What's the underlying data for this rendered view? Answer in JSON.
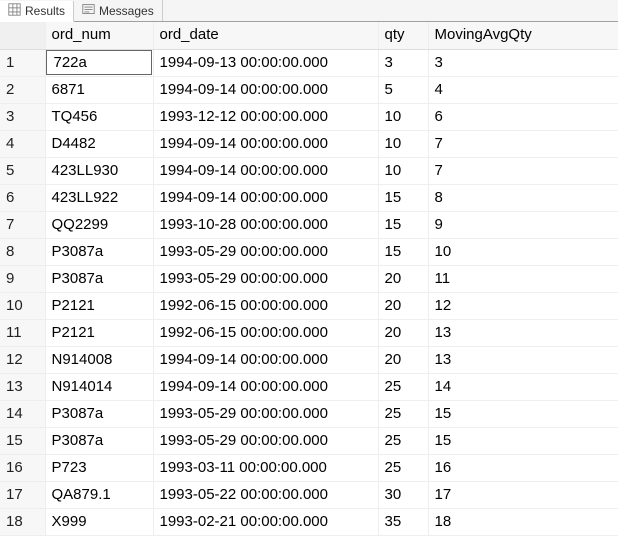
{
  "tabs": {
    "results": "Results",
    "messages": "Messages"
  },
  "columns": [
    "ord_num",
    "ord_date",
    "qty",
    "MovingAvgQty"
  ],
  "rows": [
    {
      "n": "1",
      "ord_num": "722a",
      "ord_date": "1994-09-13 00:00:00.000",
      "qty": "3",
      "mavg": "3"
    },
    {
      "n": "2",
      "ord_num": "6871",
      "ord_date": "1994-09-14 00:00:00.000",
      "qty": "5",
      "mavg": "4"
    },
    {
      "n": "3",
      "ord_num": "TQ456",
      "ord_date": "1993-12-12 00:00:00.000",
      "qty": "10",
      "mavg": "6"
    },
    {
      "n": "4",
      "ord_num": "D4482",
      "ord_date": "1994-09-14 00:00:00.000",
      "qty": "10",
      "mavg": "7"
    },
    {
      "n": "5",
      "ord_num": "423LL930",
      "ord_date": "1994-09-14 00:00:00.000",
      "qty": "10",
      "mavg": "7"
    },
    {
      "n": "6",
      "ord_num": "423LL922",
      "ord_date": "1994-09-14 00:00:00.000",
      "qty": "15",
      "mavg": "8"
    },
    {
      "n": "7",
      "ord_num": "QQ2299",
      "ord_date": "1993-10-28 00:00:00.000",
      "qty": "15",
      "mavg": "9"
    },
    {
      "n": "8",
      "ord_num": "P3087a",
      "ord_date": "1993-05-29 00:00:00.000",
      "qty": "15",
      "mavg": "10"
    },
    {
      "n": "9",
      "ord_num": "P3087a",
      "ord_date": "1993-05-29 00:00:00.000",
      "qty": "20",
      "mavg": "11"
    },
    {
      "n": "10",
      "ord_num": "P2121",
      "ord_date": "1992-06-15 00:00:00.000",
      "qty": "20",
      "mavg": "12"
    },
    {
      "n": "11",
      "ord_num": "P2121",
      "ord_date": "1992-06-15 00:00:00.000",
      "qty": "20",
      "mavg": "13"
    },
    {
      "n": "12",
      "ord_num": "N914008",
      "ord_date": "1994-09-14 00:00:00.000",
      "qty": "20",
      "mavg": "13"
    },
    {
      "n": "13",
      "ord_num": "N914014",
      "ord_date": "1994-09-14 00:00:00.000",
      "qty": "25",
      "mavg": "14"
    },
    {
      "n": "14",
      "ord_num": "P3087a",
      "ord_date": "1993-05-29 00:00:00.000",
      "qty": "25",
      "mavg": "15"
    },
    {
      "n": "15",
      "ord_num": "P3087a",
      "ord_date": "1993-05-29 00:00:00.000",
      "qty": "25",
      "mavg": "15"
    },
    {
      "n": "16",
      "ord_num": "P723",
      "ord_date": "1993-03-11 00:00:00.000",
      "qty": "25",
      "mavg": "16"
    },
    {
      "n": "17",
      "ord_num": "QA879.1",
      "ord_date": "1993-05-22 00:00:00.000",
      "qty": "30",
      "mavg": "17"
    },
    {
      "n": "18",
      "ord_num": "X999",
      "ord_date": "1993-02-21 00:00:00.000",
      "qty": "35",
      "mavg": "18"
    }
  ],
  "selected_row_index": 0
}
